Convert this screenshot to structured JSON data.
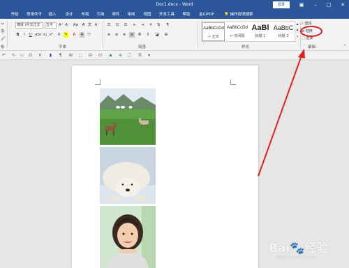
{
  "window": {
    "title": "Doc1.docx - Word",
    "login_label": "登录",
    "controls": [
      "restore-icon",
      "minimize-icon",
      "maximize-icon",
      "close-icon"
    ],
    "accent_color": "#2b579a"
  },
  "tabs": [
    "开始",
    "常用命令",
    "插入",
    "设计",
    "布局",
    "引用",
    "邮件",
    "审阅",
    "视图",
    "开发工具",
    "帮助",
    "金山PDF"
  ],
  "tell_me": "操作说明搜索",
  "ribbon": {
    "font_name": "楷体 (中文正文",
    "font_size": "五号",
    "clipboard_label": "板",
    "font_group_label": "字体",
    "paragraph_group_label": "段落",
    "styles_group_label": "样式",
    "editing_group_label": "编辑",
    "styles": [
      {
        "preview": "AaBbCcDd",
        "name": "↵ 正文"
      },
      {
        "preview": "AaBbCcDd",
        "name": "↵ 无间隔"
      },
      {
        "preview": "AaBl",
        "name": "标题 1"
      },
      {
        "preview": "AaBbC",
        "name": "标题 2"
      }
    ],
    "edit": {
      "find": "查找",
      "replace": "替换",
      "select": "选择"
    }
  },
  "annotation": {
    "color": "#e02020"
  },
  "watermark": {
    "text": "Bai🐾经验",
    "url": "jingyan.baidu.com"
  }
}
